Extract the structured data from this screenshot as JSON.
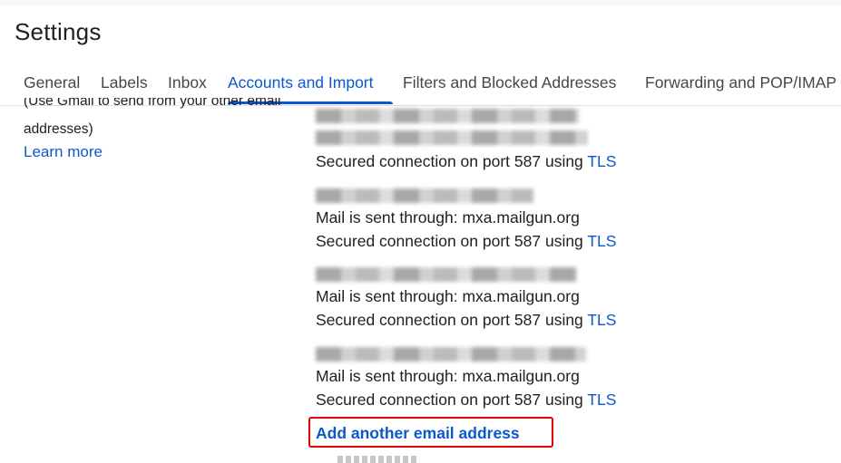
{
  "page": {
    "title": "Settings"
  },
  "tabs": [
    {
      "label": "General"
    },
    {
      "label": "Labels"
    },
    {
      "label": "Inbox"
    },
    {
      "label": "Accounts and Import",
      "active": true
    },
    {
      "label": "Filters and Blocked Addresses"
    },
    {
      "label": "Forwarding and POP/IMAP"
    }
  ],
  "left_column": {
    "line1": "(Use Gmail to send from your other email",
    "line2": "addresses)",
    "learn_more": "Learn more"
  },
  "accounts": [
    {
      "sent_through": "",
      "secured_prefix": "Secured connection on port 587 using ",
      "tls": "TLS"
    },
    {
      "sent_through": "Mail is sent through: mxa.mailgun.org",
      "secured_prefix": "Secured connection on port 587 using ",
      "tls": "TLS"
    },
    {
      "sent_through": "Mail is sent through: mxa.mailgun.org",
      "secured_prefix": "Secured connection on port 587 using ",
      "tls": "TLS"
    },
    {
      "sent_through": "Mail is sent through: mxa.mailgun.org",
      "secured_prefix": "Secured connection on port 587 using ",
      "tls": "TLS"
    }
  ],
  "add_another": "Add another email address",
  "colors": {
    "accent": "#0b57d0",
    "highlight_box": "#e30000",
    "text": "#202124"
  }
}
